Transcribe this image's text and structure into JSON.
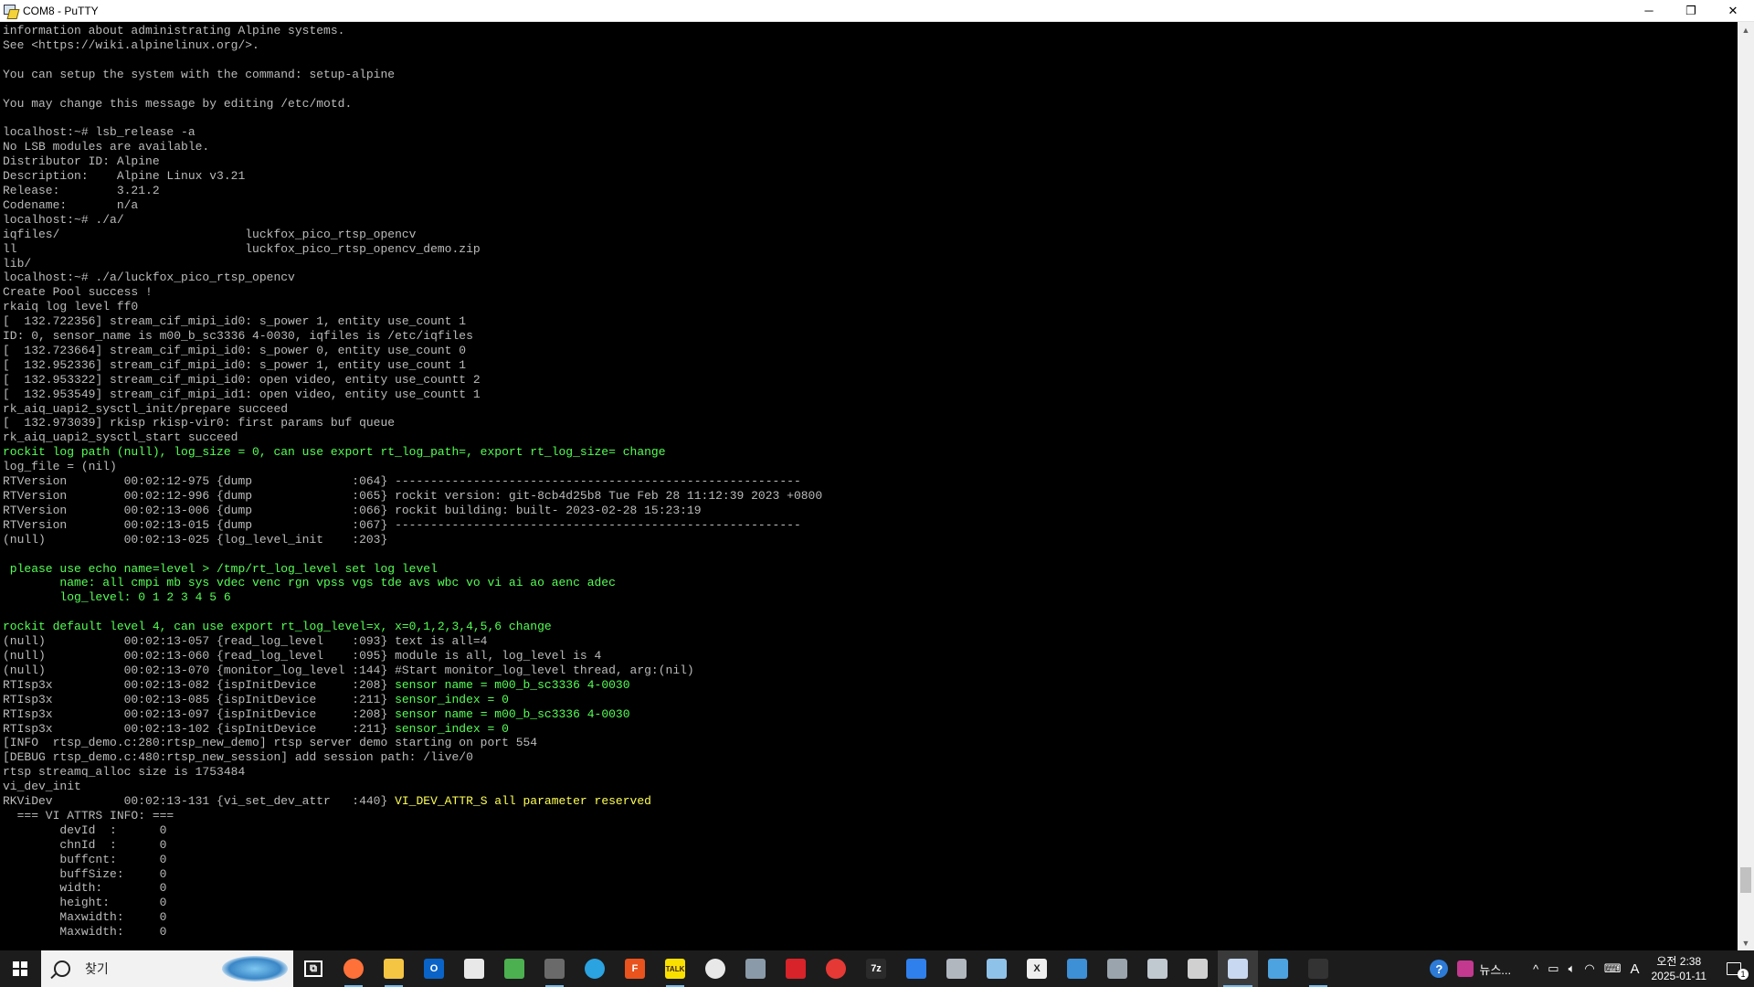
{
  "window": {
    "title": "COM8 - PuTTY",
    "minimize": "─",
    "restore": "❐",
    "close": "✕"
  },
  "terminal": {
    "lines": [
      {
        "c": "n",
        "t": "information about administrating Alpine systems."
      },
      {
        "c": "n",
        "t": "See <https://wiki.alpinelinux.org/>."
      },
      {
        "c": "n",
        "t": ""
      },
      {
        "c": "n",
        "t": "You can setup the system with the command: setup-alpine"
      },
      {
        "c": "n",
        "t": ""
      },
      {
        "c": "n",
        "t": "You may change this message by editing /etc/motd."
      },
      {
        "c": "n",
        "t": ""
      },
      {
        "c": "n",
        "t": "localhost:~# lsb_release -a"
      },
      {
        "c": "n",
        "t": "No LSB modules are available."
      },
      {
        "c": "n",
        "t": "Distributor ID: Alpine"
      },
      {
        "c": "n",
        "t": "Description:    Alpine Linux v3.21"
      },
      {
        "c": "n",
        "t": "Release:        3.21.2"
      },
      {
        "c": "n",
        "t": "Codename:       n/a"
      },
      {
        "c": "n",
        "t": "localhost:~# ./a/"
      },
      {
        "c": "n",
        "t": "iqfiles/                          luckfox_pico_rtsp_opencv"
      },
      {
        "c": "n",
        "t": "ll                                luckfox_pico_rtsp_opencv_demo.zip"
      },
      {
        "c": "n",
        "t": "lib/"
      },
      {
        "c": "n",
        "t": "localhost:~# ./a/luckfox_pico_rtsp_opencv"
      },
      {
        "c": "n",
        "t": "Create Pool success !"
      },
      {
        "c": "n",
        "t": "rkaiq log level ff0"
      },
      {
        "c": "n",
        "t": "[  132.722356] stream_cif_mipi_id0: s_power 1, entity use_count 1"
      },
      {
        "c": "n",
        "t": "ID: 0, sensor_name is m00_b_sc3336 4-0030, iqfiles is /etc/iqfiles"
      },
      {
        "c": "n",
        "t": "[  132.723664] stream_cif_mipi_id0: s_power 0, entity use_count 0"
      },
      {
        "c": "n",
        "t": "[  132.952336] stream_cif_mipi_id0: s_power 1, entity use_count 1"
      },
      {
        "c": "n",
        "t": "[  132.953322] stream_cif_mipi_id0: open video, entity use_countt 2"
      },
      {
        "c": "n",
        "t": "[  132.953549] stream_cif_mipi_id1: open video, entity use_countt 1"
      },
      {
        "c": "n",
        "t": "rk_aiq_uapi2_sysctl_init/prepare succeed"
      },
      {
        "c": "n",
        "t": "[  132.973039] rkisp rkisp-vir0: first params buf queue"
      },
      {
        "c": "n",
        "t": "rk_aiq_uapi2_sysctl_start succeed"
      },
      {
        "c": "g",
        "t": "rockit log path (null), log_size = 0, can use export rt_log_path=, export rt_log_size= change"
      },
      {
        "c": "n",
        "t": "log_file = (nil)"
      },
      {
        "c": "n",
        "t": "RTVersion        00:02:12-975 {dump              :064} ---------------------------------------------------------"
      },
      {
        "c": "n",
        "t": "RTVersion        00:02:12-996 {dump              :065} rockit version: git-8cb4d25b8 Tue Feb 28 11:12:39 2023 +0800"
      },
      {
        "c": "n",
        "t": "RTVersion        00:02:13-006 {dump              :066} rockit building: built- 2023-02-28 15:23:19"
      },
      {
        "c": "n",
        "t": "RTVersion        00:02:13-015 {dump              :067} ---------------------------------------------------------"
      },
      {
        "c": "n",
        "t": "(null)           00:02:13-025 {log_level_init    :203}"
      },
      {
        "c": "n",
        "t": ""
      },
      {
        "c": "g",
        "t": " please use echo name=level > /tmp/rt_log_level set log level"
      },
      {
        "c": "g",
        "t": "        name: all cmpi mb sys vdec venc rgn vpss vgs tde avs wbc vo vi ai ao aenc adec"
      },
      {
        "c": "g",
        "t": "        log_level: 0 1 2 3 4 5 6"
      },
      {
        "c": "n",
        "t": ""
      },
      {
        "c": "g",
        "t": "rockit default level 4, can use export rt_log_level=x, x=0,1,2,3,4,5,6 change"
      },
      {
        "c": "n",
        "t": "(null)           00:02:13-057 {read_log_level    :093} text is all=4"
      },
      {
        "c": "n",
        "t": "(null)           00:02:13-060 {read_log_level    :095} module is all, log_level is 4"
      },
      {
        "c": "n",
        "t": "(null)           00:02:13-070 {monitor_log_level :144} #Start monitor_log_level thread, arg:(nil)"
      },
      {
        "c": "mix",
        "p": "RTIsp3x          00:02:13-082 {ispInitDevice     :208} ",
        "g": "sensor name = m00_b_sc3336 4-0030"
      },
      {
        "c": "mix",
        "p": "RTIsp3x          00:02:13-085 {ispInitDevice     :211} ",
        "g": "sensor_index = 0"
      },
      {
        "c": "mix",
        "p": "RTIsp3x          00:02:13-097 {ispInitDevice     :208} ",
        "g": "sensor name = m00_b_sc3336 4-0030"
      },
      {
        "c": "mix",
        "p": "RTIsp3x          00:02:13-102 {ispInitDevice     :211} ",
        "g": "sensor_index = 0"
      },
      {
        "c": "n",
        "t": "[INFO  rtsp_demo.c:280:rtsp_new_demo] rtsp server demo starting on port 554"
      },
      {
        "c": "n",
        "t": "[DEBUG rtsp_demo.c:480:rtsp_new_session] add session path: /live/0"
      },
      {
        "c": "n",
        "t": "rtsp streamq_alloc size is 1753484"
      },
      {
        "c": "n",
        "t": "vi_dev_init"
      },
      {
        "c": "mixy",
        "p": "RKViDev          00:02:13-131 {vi_set_dev_attr   :440} ",
        "y": "VI_DEV_ATTR_S all parameter reserved"
      },
      {
        "c": "n",
        "t": "  === VI ATTRS INFO: ==="
      },
      {
        "c": "n",
        "t": "        devId  :      0"
      },
      {
        "c": "n",
        "t": "        chnId  :      0"
      },
      {
        "c": "n",
        "t": "        buffcnt:      0"
      },
      {
        "c": "n",
        "t": "        buffSize:     0"
      },
      {
        "c": "n",
        "t": "        width:        0"
      },
      {
        "c": "n",
        "t": "        height:       0"
      },
      {
        "c": "n",
        "t": "        Maxwidth:     0"
      },
      {
        "c": "n",
        "t": "        Maxwidth:     0"
      }
    ]
  },
  "taskbar": {
    "search_placeholder": "찾기",
    "apps": [
      {
        "name": "task-view-icon",
        "label": "⧉",
        "color": "#1c1c1c"
      },
      {
        "name": "firefox-icon",
        "label": "",
        "color": "#ff7139"
      },
      {
        "name": "file-explorer-icon",
        "label": "",
        "color": "#f4c542"
      },
      {
        "name": "outlook-icon",
        "label": "O",
        "color": "#0a64c8"
      },
      {
        "name": "store-icon",
        "label": "",
        "color": "#e8e8e8"
      },
      {
        "name": "notepad-icon",
        "label": "",
        "color": "#4caf50"
      },
      {
        "name": "media-app-icon",
        "label": "",
        "color": "#6a6a6a"
      },
      {
        "name": "telegram-icon",
        "label": "",
        "color": "#2aa3e0"
      },
      {
        "name": "f-app-icon",
        "label": "F",
        "color": "#e8531e"
      },
      {
        "name": "kakaotalk-icon",
        "label": "TALK",
        "color": "#f9e000"
      },
      {
        "name": "music-app-icon",
        "label": "",
        "color": "#e8e8e8"
      },
      {
        "name": "network-tool-icon",
        "label": "",
        "color": "#8a9aa8"
      },
      {
        "name": "flash-app-icon",
        "label": "",
        "color": "#d8232a"
      },
      {
        "name": "red-app-icon",
        "label": "",
        "color": "#e53935"
      },
      {
        "name": "7zip-icon",
        "label": "7z",
        "color": "#2b2b2b"
      },
      {
        "name": "draw-app-icon",
        "label": "",
        "color": "#2f80ed"
      },
      {
        "name": "disk-tool-icon",
        "label": "",
        "color": "#b0b7bf"
      },
      {
        "name": "note-app-icon",
        "label": "",
        "color": "#8fc2e8"
      },
      {
        "name": "excel-like-icon",
        "label": "X",
        "color": "#eeeeee"
      },
      {
        "name": "calculator-icon",
        "label": "",
        "color": "#3d8fd6"
      },
      {
        "name": "network-device-icon",
        "label": "",
        "color": "#9aa4ad"
      },
      {
        "name": "monitor-app-icon",
        "label": "",
        "color": "#c0c8d0"
      },
      {
        "name": "rhino-app-icon",
        "label": "",
        "color": "#d0d0d0"
      },
      {
        "name": "putty-icon",
        "label": "",
        "color": "#c8d8f0"
      },
      {
        "name": "vpn-app-icon",
        "label": "",
        "color": "#4da3e0"
      },
      {
        "name": "terminal-icon",
        "label": "",
        "color": "#333333"
      }
    ],
    "tray": {
      "help": "?",
      "news": "뉴스...",
      "chevron": "^",
      "ime": "A",
      "time": "오전 2:38",
      "date": "2025-01-11",
      "notifications": "1"
    }
  }
}
